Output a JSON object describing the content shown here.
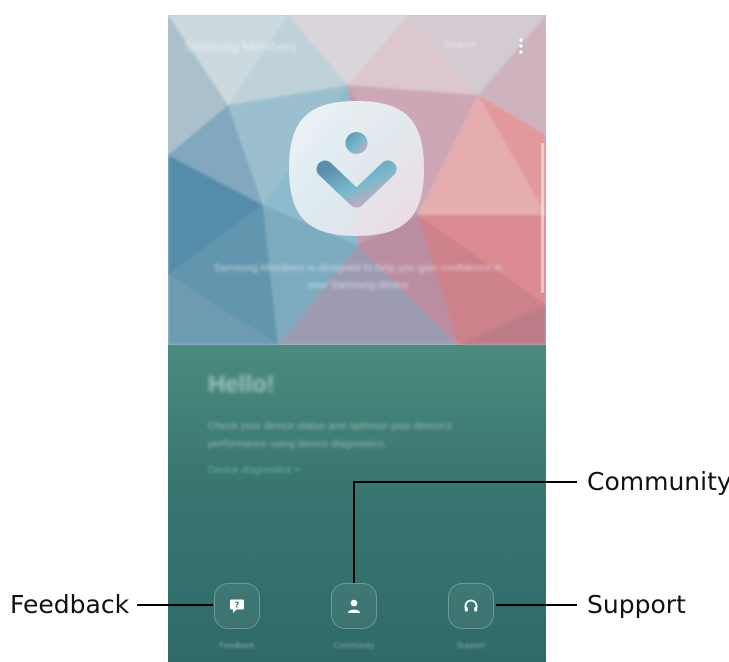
{
  "header": {
    "app_title": "Samsung Members",
    "link_label": "Search",
    "more_icon": "more-vert-icon"
  },
  "hero": {
    "logo_icon": "samsung-members-logo-icon",
    "description": "Samsung Members is designed to help you gain confidence in your Samsung device"
  },
  "content": {
    "greeting": "Hello!",
    "description": "Check your device status and optimize your device's performance using device diagnostics.",
    "link": "Device diagnostics >"
  },
  "tabs": [
    {
      "label": "Feedback",
      "icon": "feedback-icon"
    },
    {
      "label": "Community",
      "icon": "community-person-icon"
    },
    {
      "label": "Support",
      "icon": "support-headset-icon"
    }
  ],
  "callouts": {
    "feedback": "Feedback",
    "community": "Community",
    "support": "Support"
  },
  "colors": {
    "callout_line": "#000000",
    "content_bg": "#3a7771"
  }
}
